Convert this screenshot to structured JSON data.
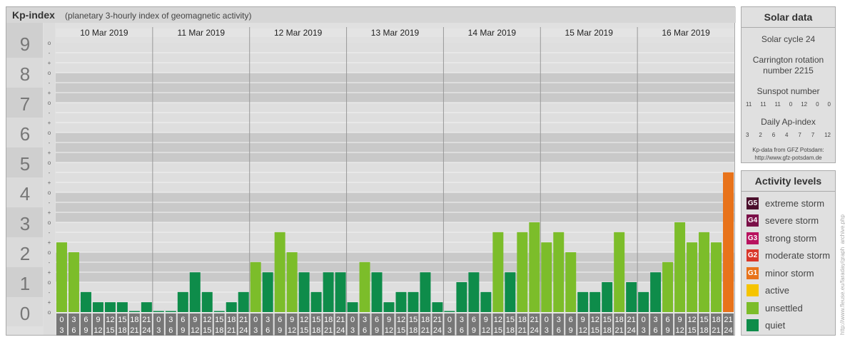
{
  "chart_title": "Kp-index",
  "chart_subtitle": "(planetary 3-hourly index of geomagnetic activity)",
  "chart_data": {
    "type": "bar",
    "title": "Kp-index",
    "subtitle": "(planetary 3-hourly index of geomagnetic activity)",
    "ylim": [
      0,
      9
    ],
    "y_ticks": [
      "0",
      "1",
      "2",
      "3",
      "4",
      "5",
      "6",
      "7",
      "8",
      "9"
    ],
    "minor_ticks": [
      "+",
      "o",
      "-"
    ],
    "days": [
      "10 Mar 2019",
      "11 Mar 2019",
      "12 Mar 2019",
      "13 Mar 2019",
      "14 Mar 2019",
      "15 Mar 2019",
      "16 Mar 2019"
    ],
    "hour_start": [
      "0",
      "3",
      "6",
      "9",
      "12",
      "15",
      "18",
      "21"
    ],
    "hour_end": [
      "3",
      "6",
      "9",
      "12",
      "15",
      "18",
      "21",
      "24"
    ],
    "values": [
      2.33,
      2.0,
      0.67,
      0.33,
      0.33,
      0.33,
      0.0,
      0.33,
      0.0,
      0.0,
      0.67,
      1.33,
      0.67,
      0.0,
      0.33,
      0.67,
      1.67,
      1.33,
      2.67,
      2.0,
      1.33,
      0.67,
      1.33,
      1.33,
      0.33,
      1.67,
      1.33,
      0.33,
      0.67,
      0.67,
      1.33,
      0.33,
      0.0,
      1.0,
      1.33,
      0.67,
      2.67,
      1.33,
      2.67,
      3.0,
      2.33,
      2.67,
      2.0,
      0.67,
      0.67,
      1.0,
      2.67,
      1.0,
      0.67,
      1.33,
      1.67,
      3.0,
      2.33,
      2.67,
      2.33,
      4.67
    ],
    "levels": [
      "unsettled",
      "unsettled",
      "quiet",
      "quiet",
      "quiet",
      "quiet",
      "quiet",
      "quiet",
      "quiet",
      "quiet",
      "quiet",
      "quiet",
      "quiet",
      "quiet",
      "quiet",
      "quiet",
      "unsettled",
      "quiet",
      "unsettled",
      "unsettled",
      "quiet",
      "quiet",
      "quiet",
      "quiet",
      "quiet",
      "unsettled",
      "quiet",
      "quiet",
      "quiet",
      "quiet",
      "quiet",
      "quiet",
      "quiet",
      "quiet",
      "quiet",
      "quiet",
      "unsettled",
      "quiet",
      "unsettled",
      "unsettled",
      "unsettled",
      "unsettled",
      "unsettled",
      "quiet",
      "quiet",
      "quiet",
      "unsettled",
      "quiet",
      "quiet",
      "quiet",
      "unsettled",
      "unsettled",
      "unsettled",
      "unsettled",
      "unsettled",
      "minor storm"
    ]
  },
  "colors": {
    "quiet": "#0e8c4a",
    "unsettled": "#7cbd2a",
    "active": "#f5c400",
    "minor storm": "#e8731b",
    "band_dark": "#c9c9c9",
    "band_light": "#dedede",
    "ytick_bg": "#858585"
  },
  "solar_data": {
    "title": "Solar data",
    "solar_cycle": "Solar cycle 24",
    "carrington_line1": "Carrington rotation",
    "carrington_line2": "number 2215",
    "sunspot_label": "Sunspot number",
    "sunspot_values": [
      "11",
      "11",
      "11",
      "0",
      "12",
      "0",
      "0"
    ],
    "ap_label": "Daily Ap-index",
    "ap_values": [
      "3",
      "2",
      "6",
      "4",
      "7",
      "7",
      "12"
    ],
    "credit_line1": "Kp-data from GFZ Potsdam:",
    "credit_line2": "http://www.gfz-potsdam.de"
  },
  "activity_levels": {
    "title": "Activity levels",
    "items": [
      {
        "badge": "G5",
        "label": "extreme storm",
        "color": "#4b0f2c"
      },
      {
        "badge": "G4",
        "label": "severe storm",
        "color": "#7a1048"
      },
      {
        "badge": "G3",
        "label": "strong storm",
        "color": "#b8125f"
      },
      {
        "badge": "G2",
        "label": "moderate storm",
        "color": "#d9372a"
      },
      {
        "badge": "G1",
        "label": "minor storm",
        "color": "#e8731b"
      },
      {
        "badge": "",
        "label": "active",
        "color": "#f5c400"
      },
      {
        "badge": "",
        "label": "unsettled",
        "color": "#7cbd2a"
      },
      {
        "badge": "",
        "label": "quiet",
        "color": "#0e8c4a"
      }
    ]
  },
  "watermark": "http://www.fleuse.eu/faraday/graph_archive.php"
}
